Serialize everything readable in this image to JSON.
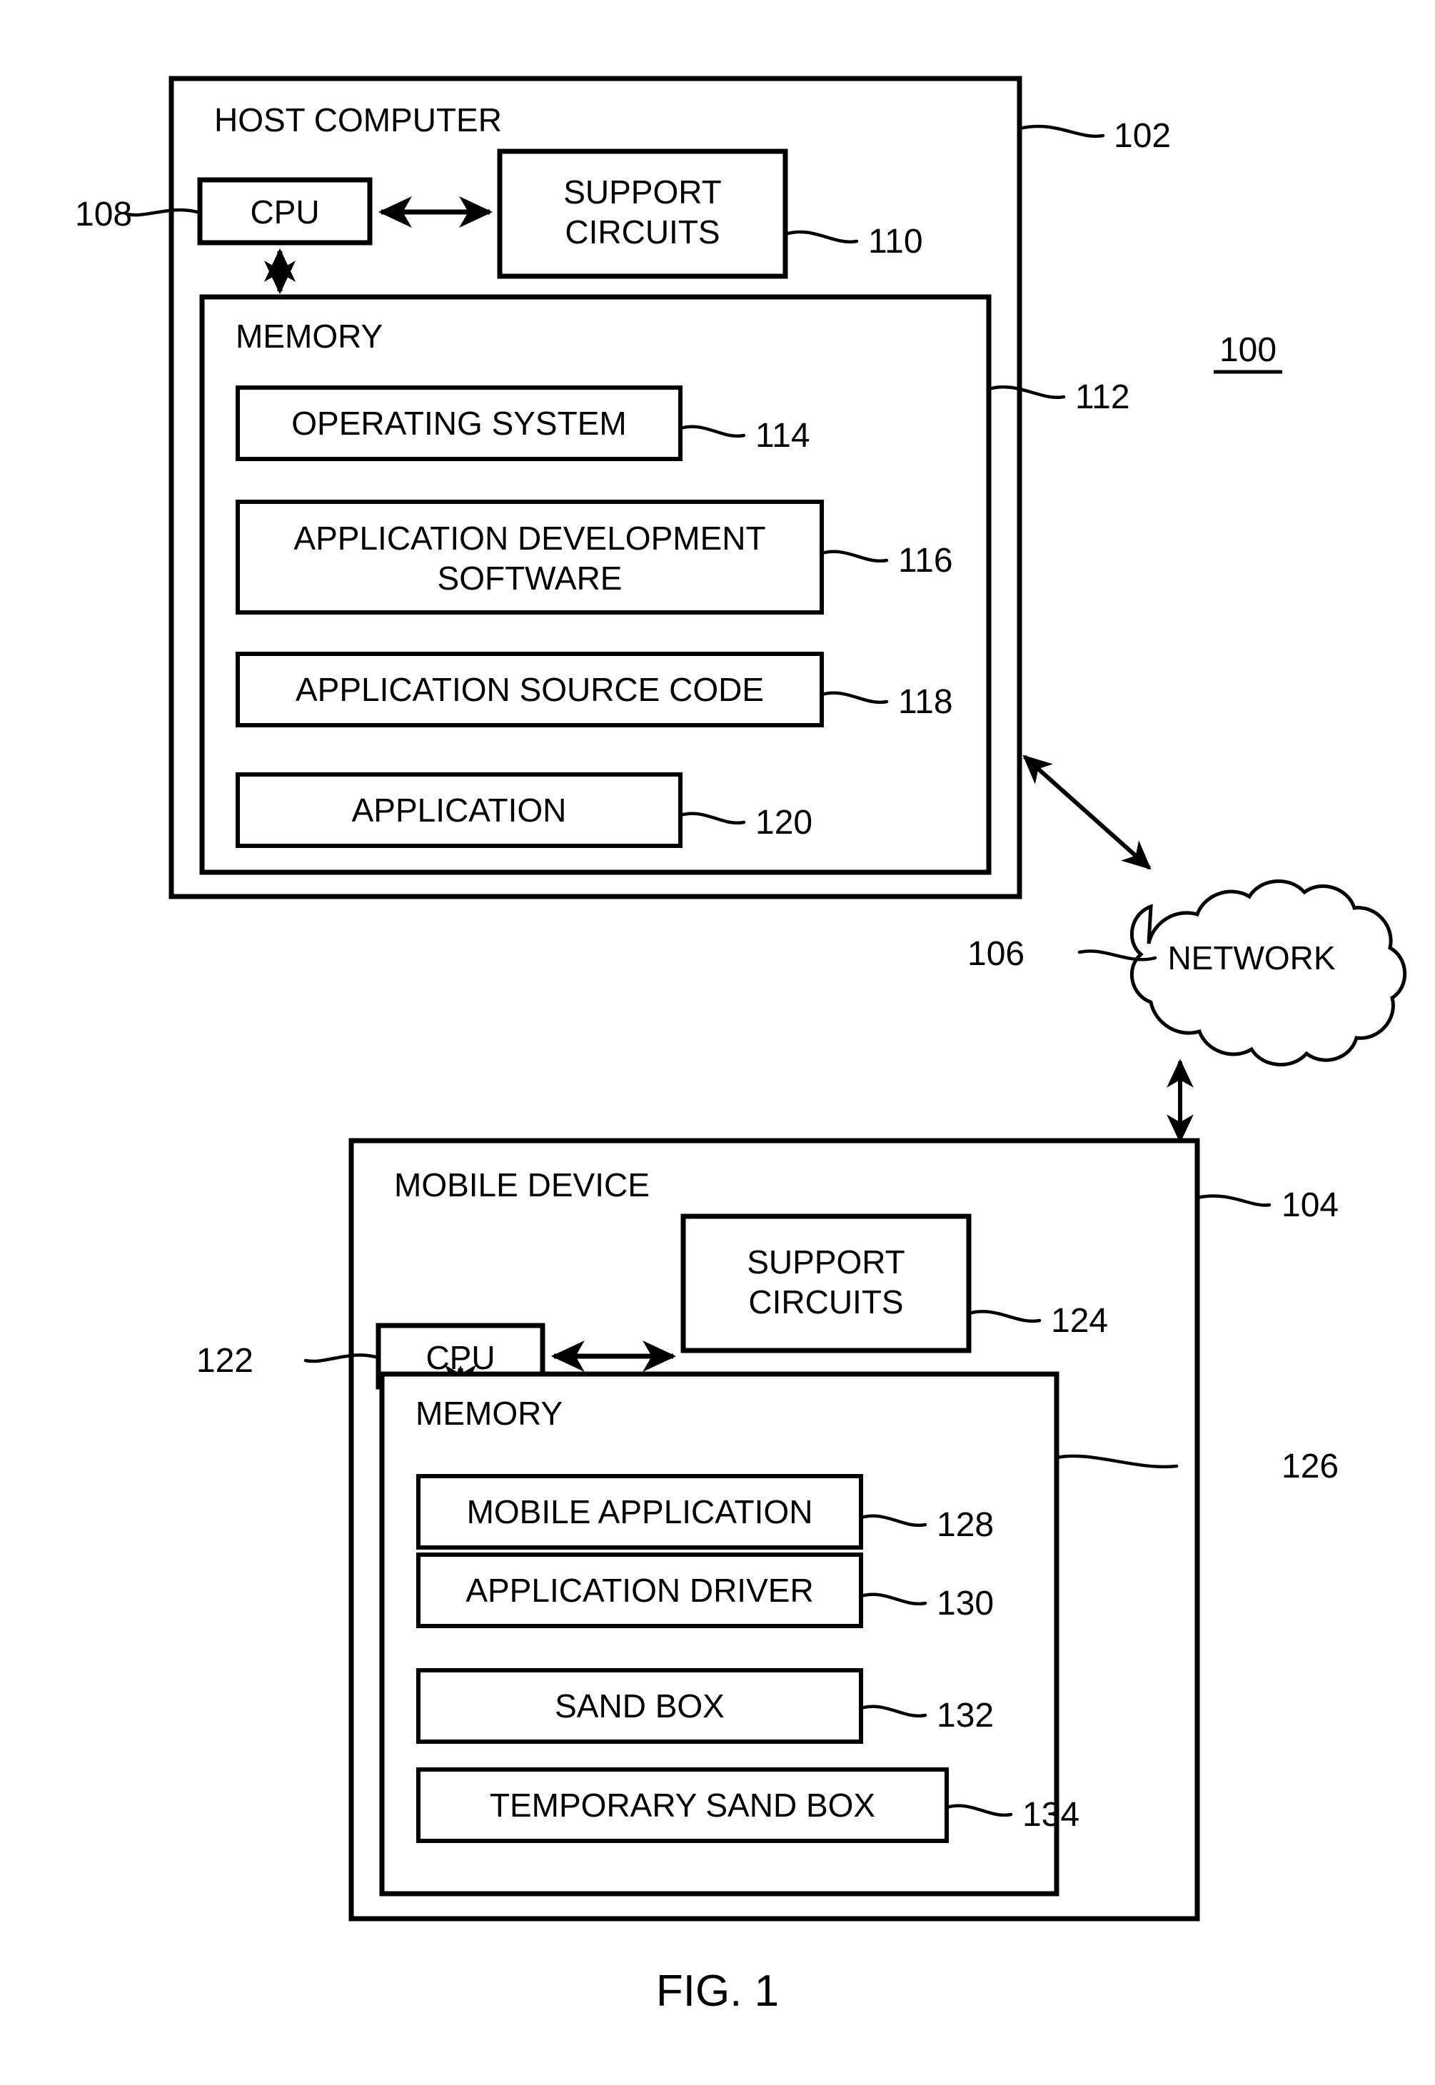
{
  "figure": {
    "caption": "FIG. 1",
    "system_ref": "100"
  },
  "host": {
    "title": "HOST COMPUTER",
    "ref": "102",
    "cpu": {
      "label": "CPU",
      "ref": "108"
    },
    "support_circuits": {
      "label_line1": "SUPPORT",
      "label_line2": "CIRCUITS",
      "ref": "110"
    },
    "memory": {
      "title": "MEMORY",
      "ref": "112",
      "items": [
        {
          "label": "OPERATING SYSTEM",
          "ref": "114"
        },
        {
          "label_line1": "APPLICATION DEVELOPMENT",
          "label_line2": "SOFTWARE",
          "ref": "116"
        },
        {
          "label": "APPLICATION SOURCE CODE",
          "ref": "118"
        },
        {
          "label": "APPLICATION",
          "ref": "120"
        }
      ]
    }
  },
  "network": {
    "label": "NETWORK",
    "ref": "106"
  },
  "mobile": {
    "title": "MOBILE DEVICE",
    "ref": "104",
    "cpu": {
      "label": "CPU",
      "ref": "122"
    },
    "support_circuits": {
      "label_line1": "SUPPORT",
      "label_line2": "CIRCUITS",
      "ref": "124"
    },
    "memory": {
      "title": "MEMORY",
      "ref": "126",
      "items": [
        {
          "label": "MOBILE APPLICATION",
          "ref": "128"
        },
        {
          "label": "APPLICATION DRIVER",
          "ref": "130"
        },
        {
          "label": "SAND BOX",
          "ref": "132"
        },
        {
          "label": "TEMPORARY SAND BOX",
          "ref": "134"
        }
      ]
    }
  },
  "colors": {
    "stroke": "#000000",
    "background": "#ffffff"
  }
}
